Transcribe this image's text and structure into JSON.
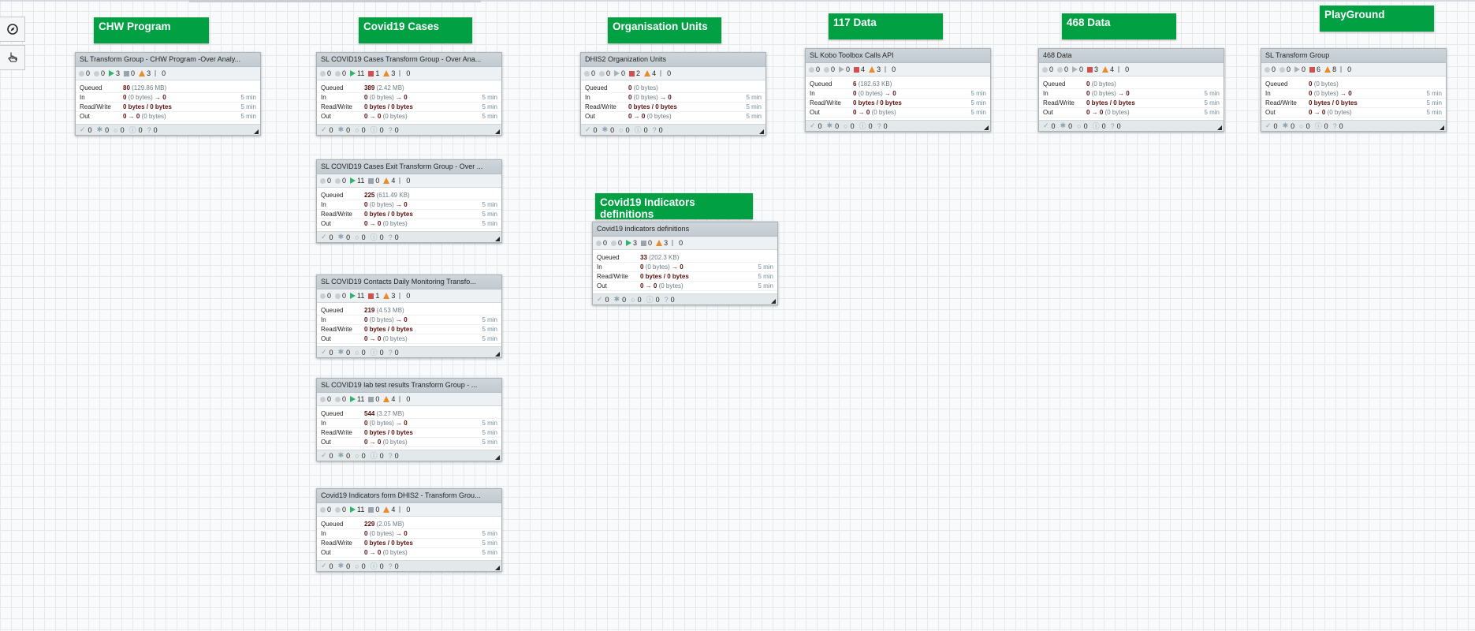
{
  "labels": [
    {
      "text": "CHW Program"
    },
    {
      "text": "Covid19 Cases"
    },
    {
      "text": "Organisation Units"
    },
    {
      "text": "117 Data"
    },
    {
      "text": "468 Data"
    },
    {
      "text": "PlayGround"
    },
    {
      "text": "Covid19 Indicators definitions"
    }
  ],
  "row_labels": {
    "queued": "Queued",
    "in": "In",
    "rw": "Read/Write",
    "out": "Out"
  },
  "time_label": "5 min",
  "groups": [
    {
      "name": "SL Transform Group - CHW Program -Over Analy...",
      "counts": {
        "transmitting": "0",
        "not_transmitting": "0",
        "running": "3",
        "stopped": "0",
        "invalid": "3",
        "disabled": "0"
      },
      "queued": "80",
      "queued_size": "(129.86 MB)",
      "in": "0",
      "in_size": "(0 bytes)",
      "in_arrow": "→ 0",
      "rw": "0 bytes / 0 bytes",
      "out": "0 → 0",
      "out_size": "(0 bytes)",
      "footer": {
        "up_to_date": "0",
        "locally_modified": "0",
        "stale": "0",
        "modified_stale": "0",
        "sync_failure": "0"
      }
    },
    {
      "name": "SL COVID19 Cases Transform Group - Over Ana...",
      "counts": {
        "transmitting": "0",
        "not_transmitting": "0",
        "running": "11",
        "stopped": "1",
        "invalid": "3",
        "disabled": "0"
      },
      "queued": "389",
      "queued_size": "(2.42 MB)",
      "in": "0",
      "in_size": "(0 bytes)",
      "in_arrow": "→ 0",
      "rw": "0 bytes / 0 bytes",
      "out": "0 → 0",
      "out_size": "(0 bytes)",
      "footer": {
        "up_to_date": "0",
        "locally_modified": "0",
        "stale": "0",
        "modified_stale": "0",
        "sync_failure": "0"
      }
    },
    {
      "name": "DHIS2 Organization Units",
      "counts": {
        "transmitting": "0",
        "not_transmitting": "0",
        "running": "0",
        "stopped": "2",
        "invalid": "4",
        "disabled": "0"
      },
      "queued": "0",
      "queued_size": "(0 bytes)",
      "in": "0",
      "in_size": "(0 bytes)",
      "in_arrow": "→ 0",
      "rw": "0 bytes / 0 bytes",
      "out": "0 → 0",
      "out_size": "(0 bytes)",
      "footer": {
        "up_to_date": "0",
        "locally_modified": "0",
        "stale": "0",
        "modified_stale": "0",
        "sync_failure": "0"
      }
    },
    {
      "name": "SL Kobo Toolbox Calls API",
      "counts": {
        "transmitting": "0",
        "not_transmitting": "0",
        "running": "0",
        "stopped": "4",
        "invalid": "3",
        "disabled": "0"
      },
      "queued": "6",
      "queued_size": "(182.63 KB)",
      "in": "0",
      "in_size": "(0 bytes)",
      "in_arrow": "→ 0",
      "rw": "0 bytes / 0 bytes",
      "out": "0 → 0",
      "out_size": "(0 bytes)",
      "footer": {
        "up_to_date": "0",
        "locally_modified": "0",
        "stale": "0",
        "modified_stale": "0",
        "sync_failure": "0"
      }
    },
    {
      "name": "468 Data",
      "counts": {
        "transmitting": "0",
        "not_transmitting": "0",
        "running": "0",
        "stopped": "3",
        "invalid": "4",
        "disabled": "0"
      },
      "queued": "0",
      "queued_size": "(0 bytes)",
      "in": "0",
      "in_size": "(0 bytes)",
      "in_arrow": "→ 0",
      "rw": "0 bytes / 0 bytes",
      "out": "0 → 0",
      "out_size": "(0 bytes)",
      "footer": {
        "up_to_date": "0",
        "locally_modified": "0",
        "stale": "0",
        "modified_stale": "0",
        "sync_failure": "0"
      }
    },
    {
      "name": "SL Transform Group",
      "counts": {
        "transmitting": "0",
        "not_transmitting": "0",
        "running": "0",
        "stopped": "6",
        "invalid": "8",
        "disabled": "0"
      },
      "queued": "0",
      "queued_size": "(0 bytes)",
      "in": "0",
      "in_size": "(0 bytes)",
      "in_arrow": "→ 0",
      "rw": "0 bytes / 0 bytes",
      "out": "0 → 0",
      "out_size": "(0 bytes)",
      "footer": {
        "up_to_date": "0",
        "locally_modified": "0",
        "stale": "0",
        "modified_stale": "0",
        "sync_failure": "0"
      }
    },
    {
      "name": "SL COVID19 Cases Exit Transform Group - Over ...",
      "counts": {
        "transmitting": "0",
        "not_transmitting": "0",
        "running": "11",
        "stopped": "0",
        "invalid": "4",
        "disabled": "0"
      },
      "queued": "225",
      "queued_size": "(611.49 KB)",
      "in": "0",
      "in_size": "(0 bytes)",
      "in_arrow": "→ 0",
      "rw": "0 bytes / 0 bytes",
      "out": "0 → 0",
      "out_size": "(0 bytes)",
      "footer": {
        "up_to_date": "0",
        "locally_modified": "0",
        "stale": "0",
        "modified_stale": "0",
        "sync_failure": "0"
      }
    },
    {
      "name": "Covid19 indicators definitions",
      "counts": {
        "transmitting": "0",
        "not_transmitting": "0",
        "running": "3",
        "stopped": "0",
        "invalid": "3",
        "disabled": "0"
      },
      "queued": "33",
      "queued_size": "(202.3 KB)",
      "in": "0",
      "in_size": "(0 bytes)",
      "in_arrow": "→ 0",
      "rw": "0 bytes / 0 bytes",
      "out": "0 → 0",
      "out_size": "(0 bytes)",
      "footer": {
        "up_to_date": "0",
        "locally_modified": "0",
        "stale": "0",
        "modified_stale": "0",
        "sync_failure": "0"
      }
    },
    {
      "name": "SL COVID19 Contacts Daily Monitoring Transfo...",
      "counts": {
        "transmitting": "0",
        "not_transmitting": "0",
        "running": "11",
        "stopped": "1",
        "invalid": "3",
        "disabled": "0"
      },
      "queued": "219",
      "queued_size": "(4.53 MB)",
      "in": "0",
      "in_size": "(0 bytes)",
      "in_arrow": "→ 0",
      "rw": "0 bytes / 0 bytes",
      "out": "0 → 0",
      "out_size": "(0 bytes)",
      "footer": {
        "up_to_date": "0",
        "locally_modified": "0",
        "stale": "0",
        "modified_stale": "0",
        "sync_failure": "0"
      }
    },
    {
      "name": "SL COVID19 lab test results Transform Group - ...",
      "counts": {
        "transmitting": "0",
        "not_transmitting": "0",
        "running": "11",
        "stopped": "0",
        "invalid": "4",
        "disabled": "0"
      },
      "queued": "544",
      "queued_size": "(3.27 MB)",
      "in": "0",
      "in_size": "(0 bytes)",
      "in_arrow": "→ 0",
      "rw": "0 bytes / 0 bytes",
      "out": "0 → 0",
      "out_size": "(0 bytes)",
      "footer": {
        "up_to_date": "0",
        "locally_modified": "0",
        "stale": "0",
        "modified_stale": "0",
        "sync_failure": "0"
      }
    },
    {
      "name": "Covid19 Indicators form DHIS2 - Transform Grou...",
      "counts": {
        "transmitting": "0",
        "not_transmitting": "0",
        "running": "11",
        "stopped": "0",
        "invalid": "4",
        "disabled": "0"
      },
      "queued": "229",
      "queued_size": "(2.05 MB)",
      "in": "0",
      "in_size": "(0 bytes)",
      "in_arrow": "→ 0",
      "rw": "0 bytes / 0 bytes",
      "out": "0 → 0",
      "out_size": "(0 bytes)",
      "footer": {
        "up_to_date": "0",
        "locally_modified": "0",
        "stale": "0",
        "modified_stale": "0",
        "sync_failure": "0"
      }
    }
  ],
  "tools": [
    {
      "icon": "compass-icon"
    },
    {
      "icon": "pointer-hand-icon"
    }
  ],
  "colors": {
    "label_green": "#00a043",
    "running": "#2cb56b",
    "stopped": "#d2514f",
    "invalid": "#e98a2b"
  }
}
